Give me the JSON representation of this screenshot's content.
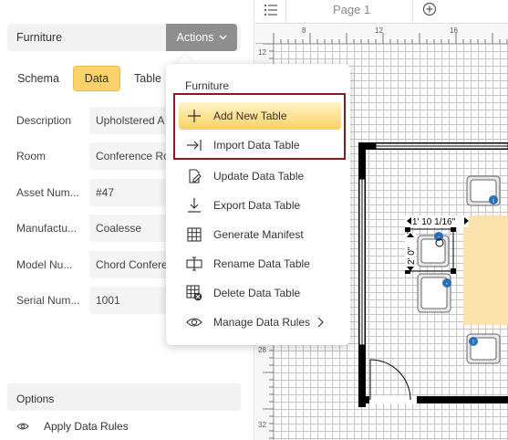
{
  "panel": {
    "title": "Furniture",
    "actions_label": "Actions",
    "tabs": [
      "Schema",
      "Data",
      "Table"
    ],
    "fields": [
      {
        "label": "Description",
        "value": "Upholstered A"
      },
      {
        "label": "Room",
        "value": "Conference Ro"
      },
      {
        "label": "Asset Num...",
        "value": "#47"
      },
      {
        "label": "Manufactu...",
        "value": "Coalesse"
      },
      {
        "label": "Model Nu...",
        "value": "Chord Confere"
      },
      {
        "label": "Serial Num...",
        "value": "1001"
      }
    ],
    "options_label": "Options",
    "apply_rules_label": "Apply Data Rules"
  },
  "canvas": {
    "page_label": "Page 1",
    "ruler_top": [
      "8",
      "12",
      "16"
    ],
    "ruler_left": [
      "12",
      "28",
      "32"
    ],
    "dimension_width": "1' 10 1/16\"",
    "dimension_depth": "2' 0\""
  },
  "menu": {
    "header": "Furniture",
    "items": [
      {
        "label": "Add New Table",
        "icon": "plus-icon"
      },
      {
        "label": "Import Data Table",
        "icon": "import-arrow-icon"
      },
      {
        "label": "Update Data Table",
        "icon": "edit-document-icon"
      },
      {
        "label": "Export Data Table",
        "icon": "download-icon"
      },
      {
        "label": "Generate Manifest",
        "icon": "grid-icon"
      },
      {
        "label": "Rename Data Table",
        "icon": "rename-icon"
      },
      {
        "label": "Delete Data Table",
        "icon": "delete-table-icon"
      },
      {
        "label": "Manage Data Rules",
        "icon": "eye-icon"
      }
    ]
  },
  "colors": {
    "active_tab": "#fbd36a",
    "actions_button": "#8e8e8e",
    "highlight_outline": "#8b1b1b",
    "table_fill": "#fbe2ad",
    "info_badge": "#2a6fb5"
  }
}
